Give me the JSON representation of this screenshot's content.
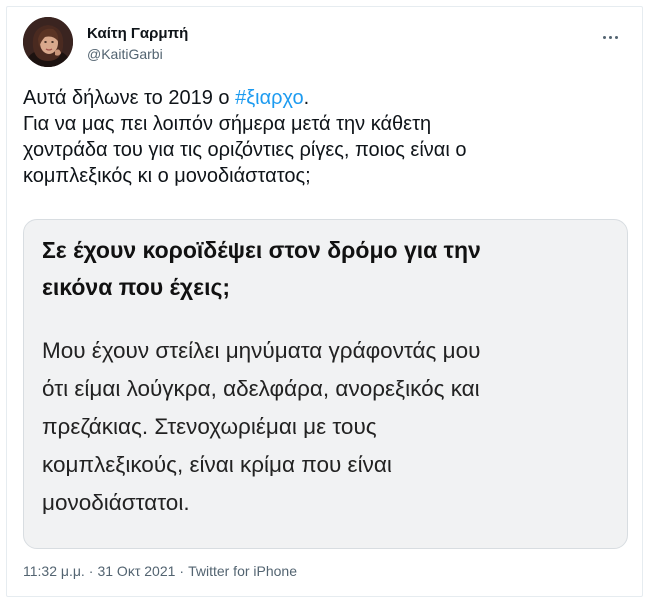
{
  "user": {
    "display_name": "Καίτη Γαρμπή",
    "handle": "@KaitiGarbi"
  },
  "tweet": {
    "line1_prefix": "Αυτά δήλωνε το 2019 ο ",
    "line1_hashtag": "#ξιαρχο",
    "line1_suffix": ".",
    "line2": "Για να μας πει λοιπόν σήμερα μετά την κάθετη",
    "line3": "χοντράδα του για τις οριζόντιες ρίγες, ποιος είναι ο",
    "line4": "κομπλεξικός κι ο μονοδιάστατος;"
  },
  "card": {
    "question_lines": [
      "Σε έχουν κοροϊδέψει στον δρόμο για την",
      "εικόνα που έχεις;"
    ],
    "answer_lines": [
      "Μου έχουν στείλει μηνύματα γράφοντάς μου",
      "ότι είμαι λούγκρα, αδελφάρα, ανορεξικός και",
      "πρεζάκιας. Στενοχωριέμαι με τους",
      "κομπλεξικούς, είναι κρίμα που είναι",
      "μονοδιάστατοι."
    ]
  },
  "meta": {
    "time": "11:32 μ.μ.",
    "date": "31 Οκτ 2021",
    "source": "Twitter for iPhone",
    "separator": "·"
  },
  "colors": {
    "hashtag": "#1d9bf0",
    "secondary_text": "#536471",
    "card_background": "#f1f2f3"
  },
  "icons": {
    "more": "more-horizontal-icon"
  }
}
